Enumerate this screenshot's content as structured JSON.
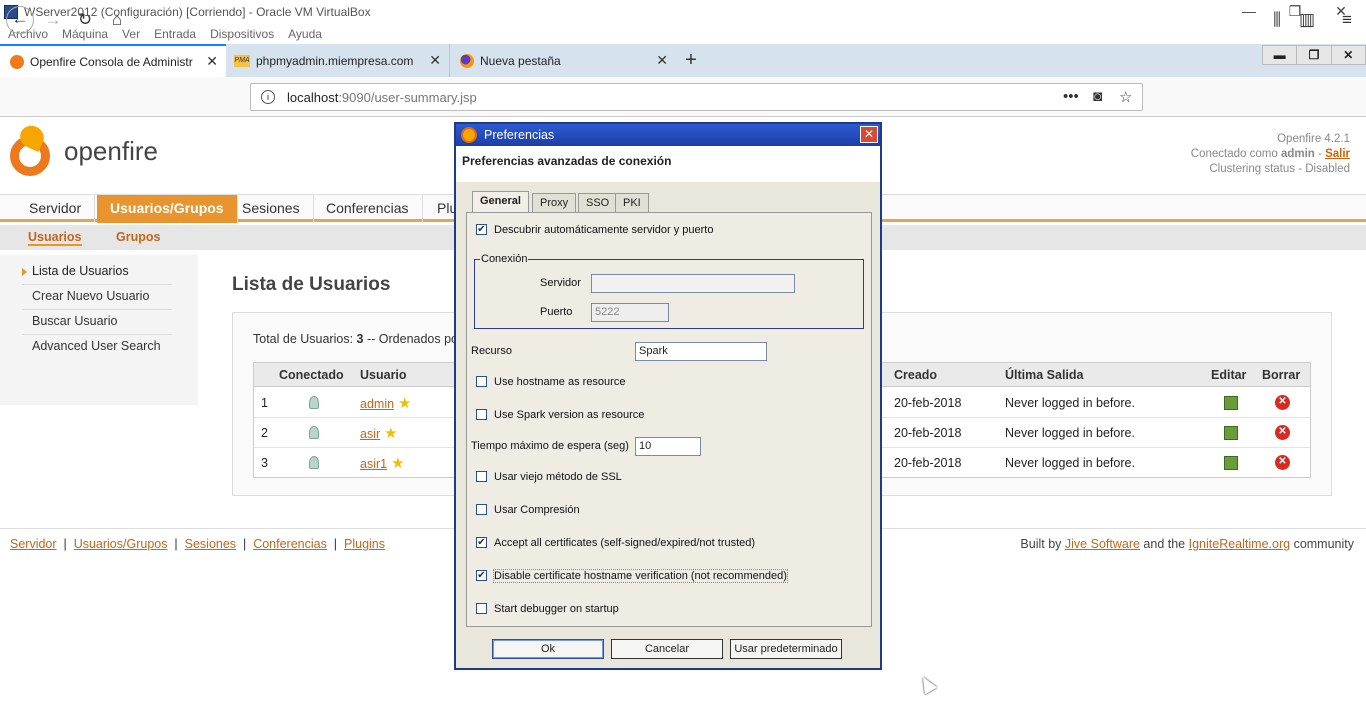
{
  "vm": {
    "title": "WServer2012 (Configuración) [Corriendo] - Oracle VM VirtualBox",
    "menu": [
      "Archivo",
      "Máquina",
      "Ver",
      "Entrada",
      "Dispositivos",
      "Ayuda"
    ],
    "controls": [
      "—",
      "❐",
      "✕"
    ]
  },
  "browser": {
    "tabs": [
      {
        "label": "Openfire Consola de Administr",
        "icon": "openfire-icon"
      },
      {
        "label": "phpmyadmin.miempresa.com",
        "icon": "phpmyadmin-icon"
      },
      {
        "label": "Nueva pestaña",
        "icon": "firefox-icon"
      }
    ],
    "url_host": "localhost",
    "url_rest": ":9090/user-summary.jsp",
    "inner_controls": [
      "▬",
      "❐",
      "✕"
    ]
  },
  "page": {
    "logo_text": "openfire",
    "version": "Openfire 4.2.1",
    "connected_as_prefix": "Conectado como",
    "connected_user": "admin",
    "logout": "Salir",
    "clustering": "Clustering status - Disabled",
    "main_nav": [
      "Servidor",
      "Usuarios/Grupos",
      "Sesiones",
      "Conferencias",
      "Plu"
    ],
    "sub_nav": [
      "Usuarios",
      "Grupos"
    ],
    "sidebar": [
      "Lista de Usuarios",
      "Crear Nuevo Usuario",
      "Buscar Usuario",
      "Advanced User Search"
    ],
    "title": "Lista de Usuarios",
    "total_label": "Total de Usuarios:",
    "total_value": "3",
    "total_suffix": "-- Ordenados po",
    "columns": [
      "Conectado",
      "Usuario",
      "Creado",
      "Última Salida",
      "Editar",
      "Borrar"
    ],
    "rows": [
      {
        "num": "1",
        "user": "admin",
        "created": "20-feb-2018",
        "last": "Never logged in before."
      },
      {
        "num": "2",
        "user": "asir",
        "created": "20-feb-2018",
        "last": "Never logged in before."
      },
      {
        "num": "3",
        "user": "asir1",
        "created": "20-feb-2018",
        "last": "Never logged in before."
      }
    ],
    "footer_links": [
      "Servidor",
      "Usuarios/Grupos",
      "Sesiones",
      "Conferencias",
      "Plugins"
    ],
    "built_by": "Built by",
    "jive": "Jive Software",
    "and_the": "and the",
    "ignite": "IgniteRealtime.org",
    "community": "community"
  },
  "dialog": {
    "title": "Preferencias",
    "heading": "Preferencias avanzadas de conexión",
    "tabs": [
      "General",
      "Proxy",
      "SSO",
      "PKI"
    ],
    "auto_discover": {
      "label": "Descubrir automáticamente servidor y puerto",
      "checked": true
    },
    "connection_legend": "Conexión",
    "server_label": "Servidor",
    "server_value": "",
    "port_label": "Puerto",
    "port_value": "5222",
    "resource_label": "Recurso",
    "resource_value": "Spark",
    "hostname_resource": {
      "label": "Use hostname as resource",
      "checked": false
    },
    "spark_version_resource": {
      "label": "Use Spark version as resource",
      "checked": false
    },
    "timeout_label": "Tiempo máximo de espera (seg)",
    "timeout_value": "10",
    "old_ssl": {
      "label": "Usar viejo método de SSL",
      "checked": false
    },
    "compression": {
      "label": "Usar Compresión",
      "checked": false
    },
    "accept_certs": {
      "label": "Accept all certificates (self-signed/expired/not trusted)",
      "checked": true
    },
    "disable_hostname": {
      "label": "Disable certificate hostname verification (not recommended)",
      "checked": true
    },
    "debugger": {
      "label": "Start debugger on startup",
      "checked": false
    },
    "buttons": {
      "ok": "Ok",
      "cancel": "Cancelar",
      "default": "Usar predeterminado"
    }
  },
  "colors": {
    "accent": "#e8942f",
    "link": "#c3661a",
    "dialog_title": "#1d3fa6"
  }
}
